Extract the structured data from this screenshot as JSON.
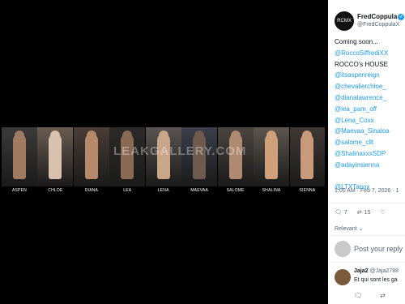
{
  "media": {
    "watermark": "LEAKGALLERY.COM",
    "models": [
      {
        "name": "ASPEN",
        "tone": "#a07a60",
        "bg": "#3a3a3a"
      },
      {
        "name": "CHLOE",
        "tone": "#d8c2ad",
        "bg": "#6b5b50"
      },
      {
        "name": "DIANA",
        "tone": "#b5896a",
        "bg": "#4a3d36"
      },
      {
        "name": "LEA",
        "tone": "#8b6a55",
        "bg": "#2c2a28"
      },
      {
        "name": "LENA",
        "tone": "#c9a58a",
        "bg": "#5a5552"
      },
      {
        "name": "MAEVAA",
        "tone": "#6e5a4e",
        "bg": "#3c3f4a"
      },
      {
        "name": "SALOME",
        "tone": "#b08a70",
        "bg": "#4b4540"
      },
      {
        "name": "SHALINA",
        "tone": "#cfa07a",
        "bg": "#5c564e"
      },
      {
        "name": "SIENNA",
        "tone": "#c99a7a",
        "bg": "#3f3834"
      }
    ]
  },
  "tweet": {
    "avatar_text": "RCMX",
    "display_name": "FredCoppula",
    "handle": "@FredCoppulaX",
    "lines": [
      {
        "text": "Coming soon...",
        "link": false
      },
      {
        "text": "@RoccoSiffrediXX",
        "link": true
      },
      {
        "text": "ROCCO's HOUSE",
        "link": false
      },
      {
        "text": "@itsaspenreign",
        "link": true
      },
      {
        "text": "@chevalierchloe_",
        "link": true
      },
      {
        "text": "@dianalawrence_",
        "link": true
      },
      {
        "text": "@lea_pam_off",
        "link": true
      },
      {
        "text": "@Lena_Coxx",
        "link": true
      },
      {
        "text": "@Maevaa_Sinaloa",
        "link": true
      },
      {
        "text": "@salome_cllt",
        "link": true
      },
      {
        "text": "@ShalinaxxxSDP",
        "link": true
      },
      {
        "text": "@adayinsienna",
        "link": true
      },
      {
        "text": "",
        "link": false
      },
      {
        "text": "@LTXTanox",
        "link": true
      }
    ],
    "timestamp": "1:00 AM · Feb 7, 2026 · 1",
    "replies": "7",
    "reposts": "15",
    "sort": "Relevant"
  },
  "composer": {
    "placeholder": "Post your reply"
  },
  "reply": {
    "name": "Jaja2",
    "handle": "@Jaja2788",
    "text": "Et qui sont les ga"
  }
}
